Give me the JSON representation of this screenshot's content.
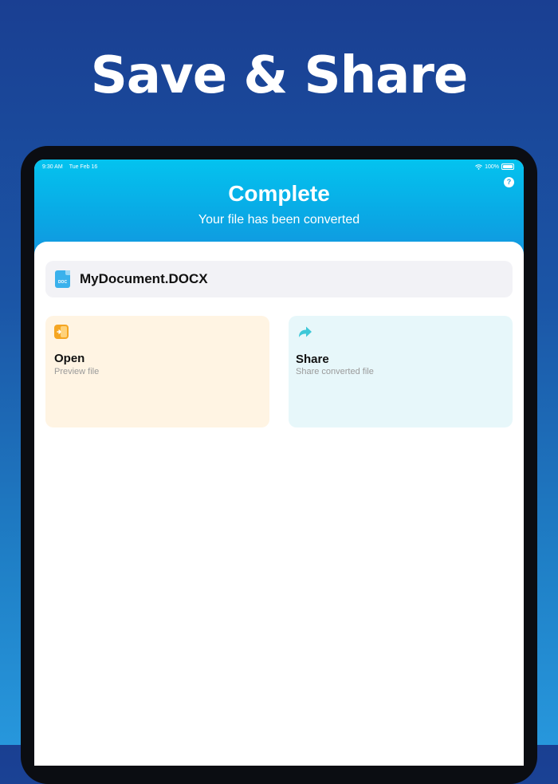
{
  "promo": {
    "title": "Save & Share"
  },
  "status_bar": {
    "time": "9:30 AM",
    "date": "Tue Feb 16",
    "battery": "100%"
  },
  "header": {
    "title": "Complete",
    "subtitle": "Your file has been converted",
    "help_label": "?"
  },
  "file": {
    "name": "MyDocument.DOCX",
    "icon_label": "DOC",
    "icon": "doc-file-icon"
  },
  "actions": [
    {
      "title": "Open",
      "subtitle": "Preview file",
      "icon": "open-preview-icon",
      "color": "#fff4e3"
    },
    {
      "title": "Share",
      "subtitle": "Share converted file",
      "icon": "share-arrow-icon",
      "color": "#e7f7fa"
    }
  ],
  "colors": {
    "accent": "#04c3ef",
    "background_top": "#1a3f92",
    "open_icon": "#f5a623",
    "share_icon": "#3ec8d8"
  }
}
